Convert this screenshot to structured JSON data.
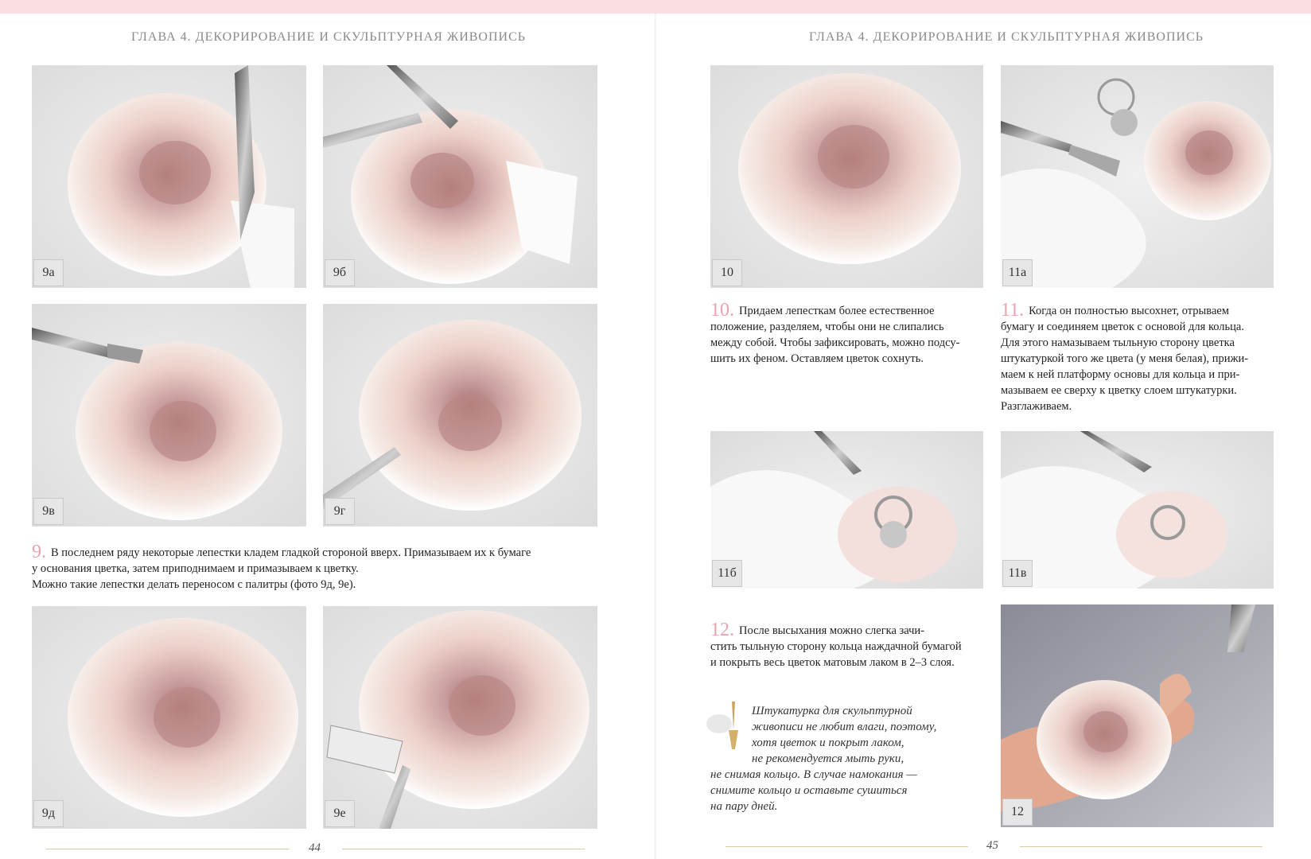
{
  "left_page": {
    "header": "ГЛАВА 4. ДЕКОРИРОВАНИЕ И СКУЛЬПТУРНАЯ ЖИВОПИСЬ",
    "photos": [
      {
        "label": "9а"
      },
      {
        "label": "9б"
      },
      {
        "label": "9в"
      },
      {
        "label": "9г"
      },
      {
        "label": "9д"
      },
      {
        "label": "9е"
      }
    ],
    "step9": {
      "number": "9.",
      "line1": "В последнем ряду некоторые лепестки кладем гладкой стороной вверх. Примазываем их к бумаге",
      "line2": "у основания цветка, затем приподнимаем и примазываем к цветку.",
      "line3": "Можно такие лепестки делать переносом с палитры (фото 9д, 9е)."
    },
    "page_number": "44"
  },
  "right_page": {
    "header": "ГЛАВА 4. ДЕКОРИРОВАНИЕ И СКУЛЬПТУРНАЯ ЖИВОПИСЬ",
    "photos": [
      {
        "label": "10"
      },
      {
        "label": "11а"
      },
      {
        "label": "11б"
      },
      {
        "label": "11в"
      },
      {
        "label": "12"
      }
    ],
    "step10": {
      "number": "10.",
      "lines": [
        "Придаем лепесткам более естественное",
        "положение, разделяем, чтобы они не слипались",
        "между собой. Чтобы зафиксировать, можно подсу-",
        "шить их феном. Оставляем цветок сохнуть."
      ]
    },
    "step11": {
      "number": "11.",
      "lines": [
        "Когда он полностью высохнет, отрываем",
        "бумагу и соединяем цветок с основой для кольца.",
        "Для этого намазываем тыльную сторону цветка",
        "штукатуркой того же цвета (у меня белая), прижи-",
        "маем к ней платформу основы для кольца и при-",
        "мазываем ее сверху к цветку слоем штукатурки.",
        "Разглаживаем."
      ]
    },
    "step12": {
      "number": "12.",
      "lines": [
        "После высыхания можно слегка зачи-",
        "стить тыльную сторону кольца наждачной бумагой",
        "и покрыть весь цветок матовым лаком в 2–3 слоя."
      ]
    },
    "note": {
      "lines": [
        "Штукатурка для скульптурной",
        "живописи не любит влаги, поэтому,",
        "хотя цветок и покрыт лаком,",
        "не рекомендуется мыть руки,",
        "не снимая кольцо. В случае намокания —",
        "снимите кольцо и оставьте сушиться",
        "на пару дней."
      ]
    },
    "page_number": "45"
  },
  "colors": {
    "top_bar": "#f9dde1",
    "step_number": "#e9a3ad",
    "rose_pink": "#d9a9a6",
    "footer_line": "#e0c8a8"
  }
}
